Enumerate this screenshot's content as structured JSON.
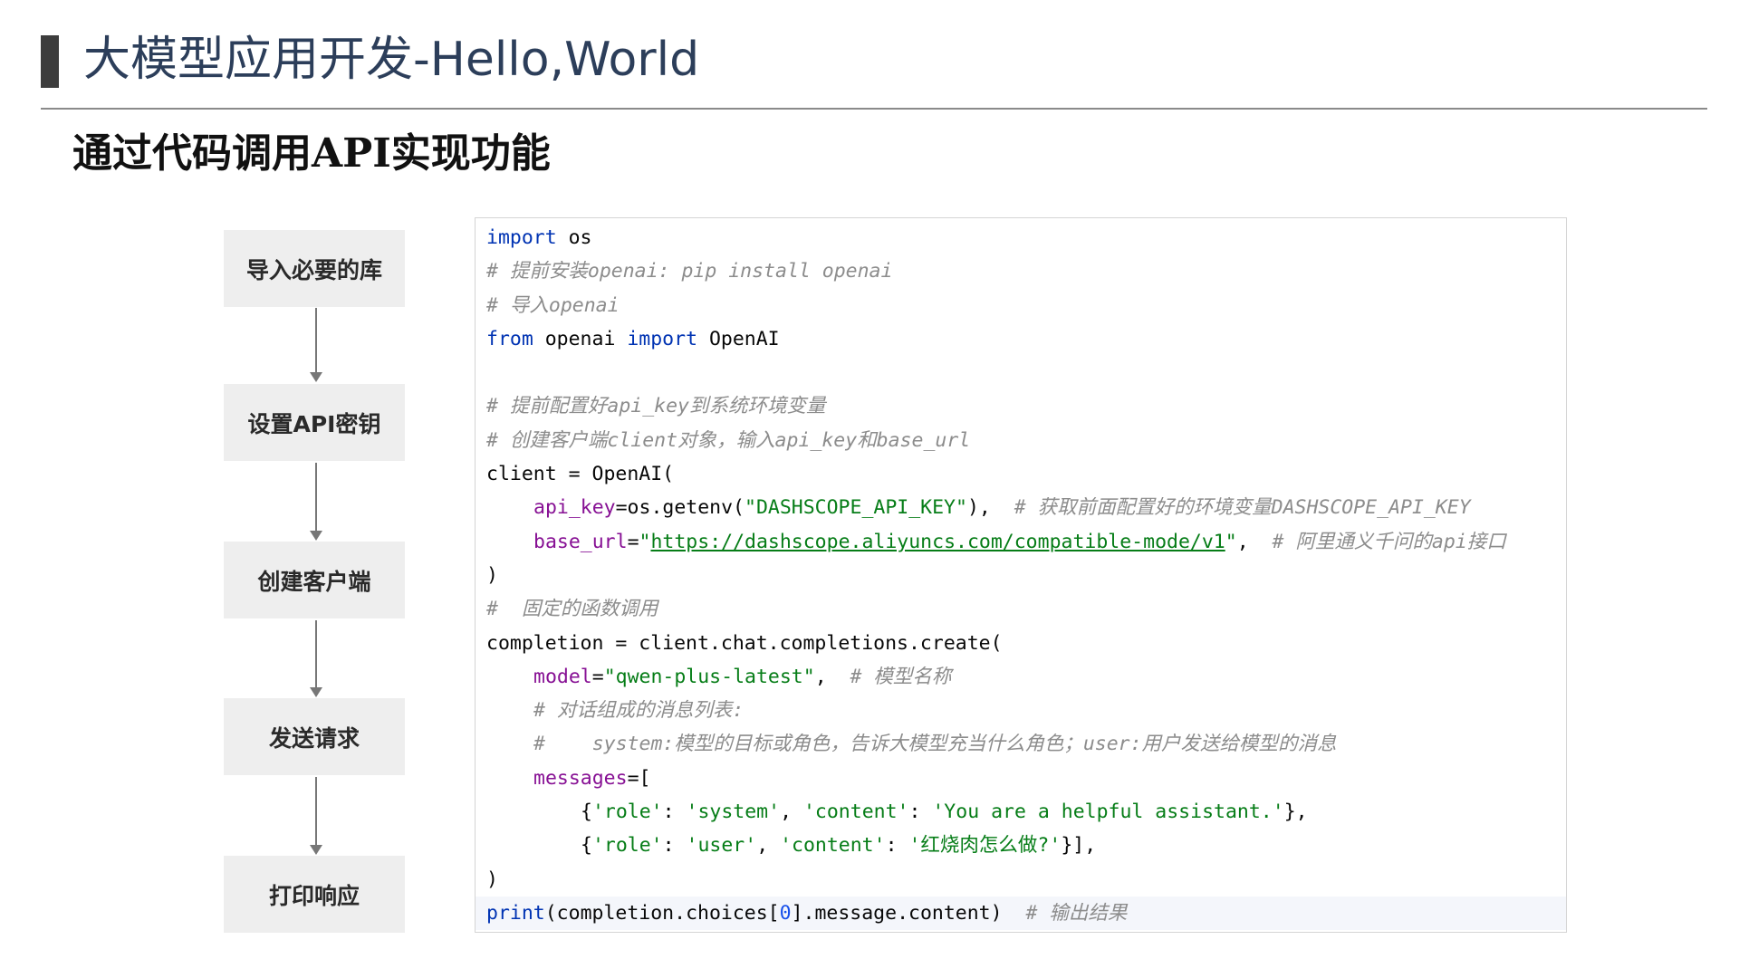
{
  "slide": {
    "title": "大模型应用开发-Hello,World",
    "subtitle": "通过代码调用API实现功能"
  },
  "flow": {
    "steps": [
      "导入必要的库",
      "设置API密钥",
      "创建客户端",
      "发送请求",
      "打印响应"
    ]
  },
  "code": {
    "l1": {
      "kw": "import",
      "rest": " os"
    },
    "l2": "# 提前安装openai: pip install openai",
    "l3": "# 导入openai",
    "l4": {
      "kw1": "from",
      "mid": " openai ",
      "kw2": "import",
      "rest": " OpenAI"
    },
    "l6": "# 提前配置好api_key到系统环境变量",
    "l7": "# 创建客户端client对象，输入api_key和base_url",
    "l8": "client = OpenAI(",
    "l9": {
      "param": "api_key",
      "eq": "=os.getenv(",
      "str": "\"DASHSCOPE_API_KEY\"",
      "close": "),  ",
      "comment": "# 获取前面配置好的环境变量DASHSCOPE_API_KEY"
    },
    "l10": {
      "param": "base_url",
      "eq": "=",
      "q1": "\"",
      "url": "https://dashscope.aliyuncs.com/compatible-mode/v1",
      "q2": "\"",
      "close": ",  ",
      "comment": "# 阿里通义千问的api接口"
    },
    "l11": ")",
    "l12": "#  固定的函数调用",
    "l13": "completion = client.chat.completions.create(",
    "l14": {
      "param": "model",
      "eq": "=",
      "str": "\"qwen-plus-latest\"",
      "close": ",  ",
      "comment": "# 模型名称"
    },
    "l15": "# 对话组成的消息列表:",
    "l16": "#    system:模型的目标或角色，告诉大模型充当什么角色；user:用户发送给模型的消息",
    "l17": {
      "param": "messages",
      "rest": "=["
    },
    "l18": {
      "o": "{",
      "k1": "'role'",
      "c1": ": ",
      "v1": "'system'",
      "c2": ", ",
      "k2": "'content'",
      "c3": ": ",
      "v2": "'You are a helpful assistant.'",
      "e": "},"
    },
    "l19": {
      "o": "{",
      "k1": "'role'",
      "c1": ": ",
      "v1": "'user'",
      "c2": ", ",
      "k2": "'content'",
      "c3": ": ",
      "v2": "'红烧肉怎么做?'",
      "e": "}],"
    },
    "l20": ")",
    "l21": {
      "kw": "print",
      "a": "(completion.choices[",
      "num": "0",
      "b": "].message.content)  ",
      "comment": "# 输出结果"
    }
  }
}
